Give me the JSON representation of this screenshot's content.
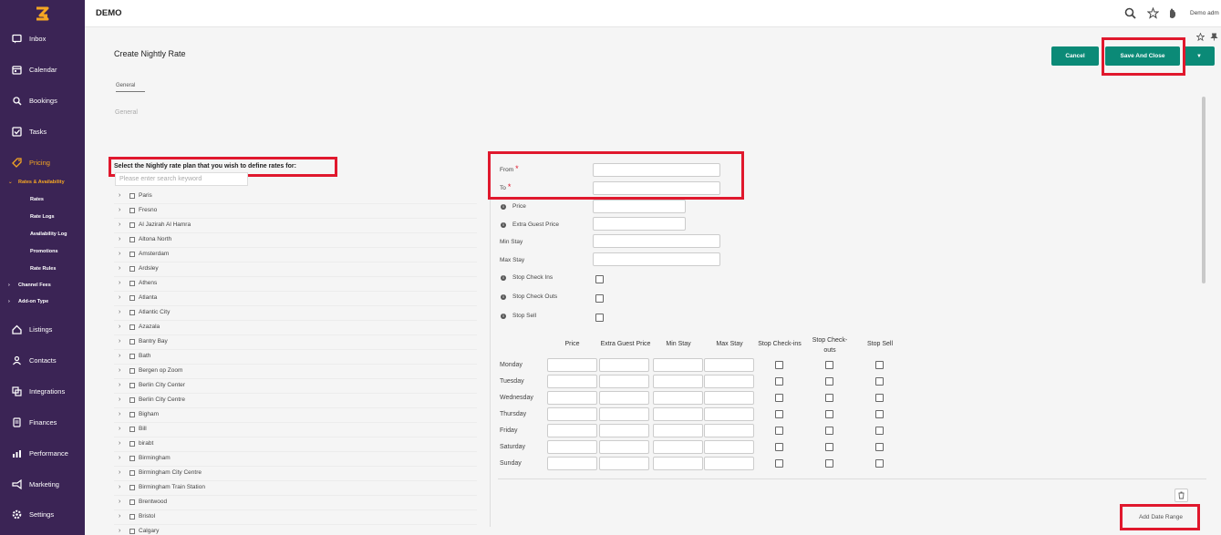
{
  "topbar": {
    "brand": "DEMO",
    "user": "Demo adm"
  },
  "sidebar": {
    "items": [
      {
        "label": "Inbox",
        "icon": "inbox-icon"
      },
      {
        "label": "Calendar",
        "icon": "calendar-icon"
      },
      {
        "label": "Bookings",
        "icon": "bookings-icon"
      },
      {
        "label": "Tasks",
        "icon": "tasks-icon"
      },
      {
        "label": "Pricing",
        "icon": "pricing-icon"
      },
      {
        "label": "Listings",
        "icon": "listings-icon"
      },
      {
        "label": "Contacts",
        "icon": "contacts-icon"
      },
      {
        "label": "Integrations",
        "icon": "integrations-icon"
      },
      {
        "label": "Finances",
        "icon": "finances-icon"
      },
      {
        "label": "Performance",
        "icon": "performance-icon"
      },
      {
        "label": "Marketing",
        "icon": "marketing-icon"
      },
      {
        "label": "Settings",
        "icon": "settings-icon"
      }
    ],
    "pricing_sub": {
      "rates_availability": "Rates & Availability",
      "children": [
        "Rates",
        "Rate Logs",
        "Availability Log",
        "Promotions",
        "Rate Rules"
      ],
      "channel_fees": "Channel Fees",
      "addon_type": "Add-on Type"
    }
  },
  "page": {
    "title": "Create Nightly Rate",
    "tab": "General",
    "section": "General",
    "cancel_label": "Cancel",
    "save_label": "Save And Close"
  },
  "rate_plans": {
    "title": "Select the Nightly rate plan that you wish to define rates for:",
    "search_placeholder": "Please enter search keyword",
    "items": [
      "Paris",
      "Fresno",
      "Al Jazirah Al Hamra",
      "Altona North",
      "Amsterdam",
      "Ardsley",
      "Athens",
      "Atlanta",
      "Atlantic City",
      "Azazala",
      "Bantry Bay",
      "Bath",
      "Bergen op Zoom",
      "Berlin City Center",
      "Berlin City Centre",
      "Bigham",
      "Bill",
      "birabt",
      "Birmingham",
      "Birmingham City Centre",
      "Birmingham Train Station",
      "Brentwood",
      "Bristol",
      "Calgary"
    ]
  },
  "form": {
    "from_label": "From",
    "to_label": "To",
    "price_label": "Price",
    "extra_guest_label": "Extra Guest Price",
    "min_stay_label": "Min Stay",
    "max_stay_label": "Max Stay",
    "stop_checkins_label": "Stop Check Ins",
    "stop_checkouts_label": "Stop Check Outs",
    "stop_sell_label": "Stop Sell",
    "required_mark": "*"
  },
  "weekly": {
    "headers": [
      "Price",
      "Extra Guest Price",
      "Min Stay",
      "Max Stay",
      "Stop Check-ins",
      "Stop Check-outs",
      "Stop Sell"
    ],
    "days": [
      "Monday",
      "Tuesday",
      "Wednesday",
      "Thursday",
      "Friday",
      "Saturday",
      "Sunday"
    ]
  },
  "add_date_range_label": "Add Date Range",
  "colors": {
    "sidebar": "#3b2455",
    "accent": "#f5a623",
    "primary": "#0b8a77",
    "highlight": "#e0182d"
  }
}
